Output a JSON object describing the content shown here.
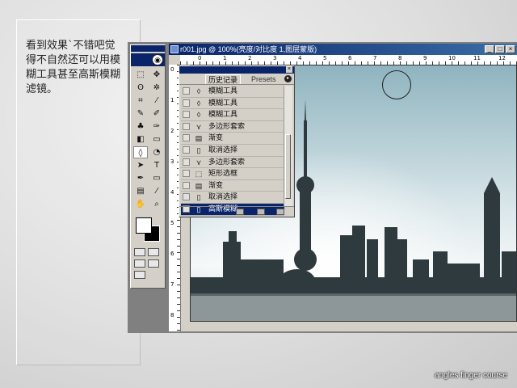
{
  "note": {
    "text": "看到效果`不错吧觉得不自然还可以用模糊工具甚至高斯模糊滤镜。"
  },
  "footer": {
    "credit": "angles finger course"
  },
  "document": {
    "title": "r001.jpg @ 100%(亮度/对比度 1,图层蒙版)",
    "buttons": {
      "minimize": "_",
      "maximize": "□",
      "close": "×"
    },
    "ruler_h": [
      "0",
      "1",
      "2",
      "3",
      "4",
      "5",
      "6",
      "7",
      "8",
      "9",
      "10",
      "11",
      "12"
    ],
    "ruler_v": [
      "0",
      "1",
      "2",
      "3",
      "4",
      "5",
      "6",
      "7",
      "8"
    ]
  },
  "history_panel": {
    "tabs": {
      "history": "历史记录",
      "presets": "Presets"
    },
    "close": "×",
    "menu": "▸",
    "items": [
      {
        "icon": "blur-drop-icon",
        "glyph": "◊",
        "label": "模糊工具"
      },
      {
        "icon": "blur-drop-icon",
        "glyph": "◊",
        "label": "模糊工具"
      },
      {
        "icon": "blur-drop-icon",
        "glyph": "◊",
        "label": "模糊工具"
      },
      {
        "icon": "polygon-lasso-icon",
        "glyph": "⋎",
        "label": "多边形套索"
      },
      {
        "icon": "gradient-icon",
        "glyph": "▤",
        "label": "渐变"
      },
      {
        "icon": "document-icon",
        "glyph": "▯",
        "label": "取消选择"
      },
      {
        "icon": "polygon-lasso-icon",
        "glyph": "⋎",
        "label": "多边形套索"
      },
      {
        "icon": "rect-marquee-icon",
        "glyph": "⬚",
        "label": "矩形选框"
      },
      {
        "icon": "gradient-icon",
        "glyph": "▤",
        "label": "渐变"
      },
      {
        "icon": "document-icon",
        "glyph": "▯",
        "label": "取消选择"
      },
      {
        "icon": "filter-icon",
        "glyph": "▯",
        "label": "高斯模糊"
      }
    ],
    "active_index": 10
  },
  "toolbox": {
    "logo": "◉",
    "tools": [
      {
        "name": "marquee-tool-icon",
        "glyph": "⬚"
      },
      {
        "name": "move-tool-icon",
        "glyph": "✥"
      },
      {
        "name": "lasso-tool-icon",
        "glyph": "ʘ"
      },
      {
        "name": "magic-wand-tool-icon",
        "glyph": "✲"
      },
      {
        "name": "crop-tool-icon",
        "glyph": "⌗"
      },
      {
        "name": "slice-tool-icon",
        "glyph": "⁄"
      },
      {
        "name": "healing-brush-icon",
        "glyph": "✎"
      },
      {
        "name": "brush-tool-icon",
        "glyph": "✐"
      },
      {
        "name": "clone-stamp-icon",
        "glyph": "♣"
      },
      {
        "name": "history-brush-icon",
        "glyph": "✑"
      },
      {
        "name": "eraser-tool-icon",
        "glyph": "◧"
      },
      {
        "name": "gradient-tool-icon",
        "glyph": "▭"
      },
      {
        "name": "blur-tool-icon",
        "glyph": "◊"
      },
      {
        "name": "dodge-tool-icon",
        "glyph": "◔"
      },
      {
        "name": "path-select-icon",
        "glyph": "➤"
      },
      {
        "name": "type-tool-icon",
        "glyph": "T"
      },
      {
        "name": "pen-tool-icon",
        "glyph": "✒"
      },
      {
        "name": "shape-tool-icon",
        "glyph": "▭"
      },
      {
        "name": "notes-tool-icon",
        "glyph": "▤"
      },
      {
        "name": "eyedropper-icon",
        "glyph": "⁄"
      },
      {
        "name": "hand-tool-icon",
        "glyph": "✋"
      },
      {
        "name": "zoom-tool-icon",
        "glyph": "⌕"
      }
    ],
    "selected_tool": 12
  }
}
